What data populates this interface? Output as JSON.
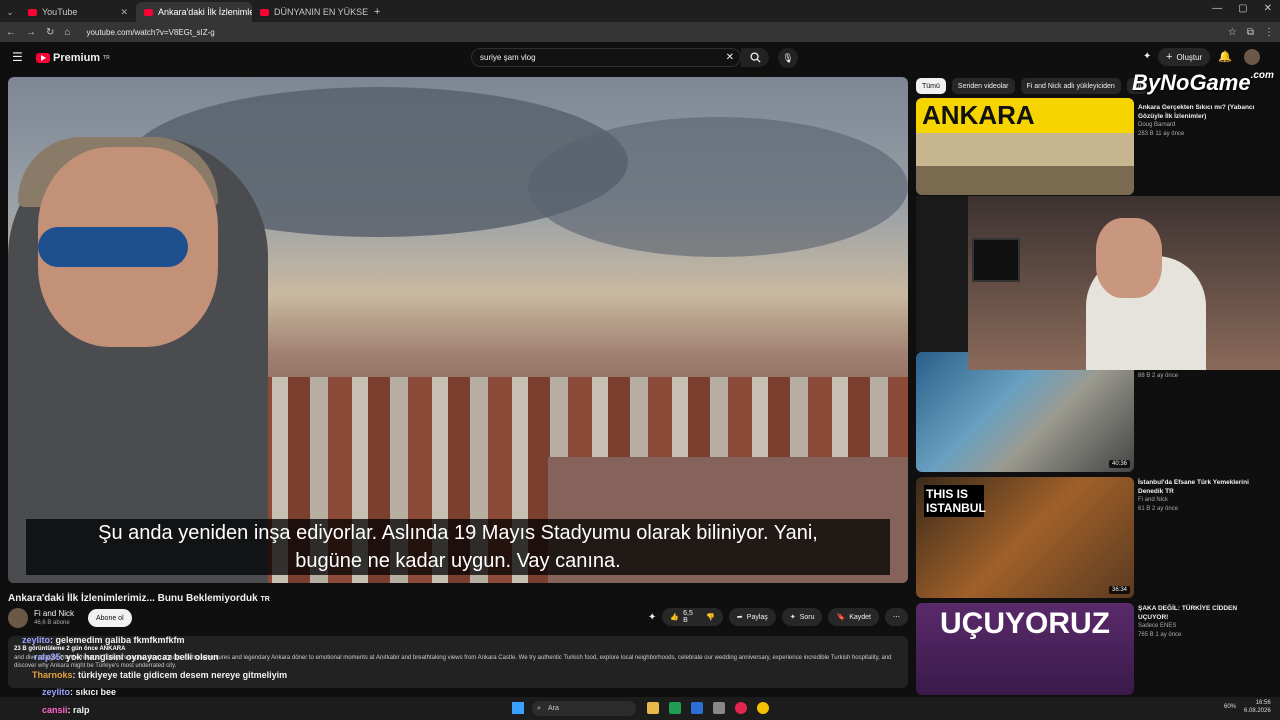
{
  "browser": {
    "tabs": [
      {
        "label": "YouTube",
        "active": false
      },
      {
        "label": "Ankara'daki İlk İzlenimlerimiz...",
        "active": true
      },
      {
        "label": "DÜNYANIN EN YÜKSEK OTELİN...",
        "active": false
      }
    ],
    "url": "youtube.com/watch?v=V8EGt_sIZ-g"
  },
  "youtube": {
    "brand": "Premium",
    "brand_suffix": "TR",
    "search_value": "suriye şam vlog",
    "create_label": "Oluştur"
  },
  "video": {
    "subtitle_line1": "Şu anda yeniden inşa ediyorlar. Aslında 19 Mayıs Stadyumu olarak biliniyor. Yani,",
    "subtitle_line2": "bugüne ne kadar uygun. Vay canına.",
    "title": "Ankara'daki İlk İzlenimlerimiz... Bunu Beklemiyorduk",
    "title_suffix": "TR",
    "channel": "Fi and Nick",
    "subscribers": "46,6 B abone",
    "subscribe_label": "Abone ol",
    "like_count": "6,5 B",
    "share_label": "Paylaş",
    "ask_label": "Soru",
    "save_label": "Kaydet",
    "desc_meta": "23 B görüntüleme  2 gün önce  ANKARA",
    "desc_text": "and dive straight into the heart of Türkiye's capital, from chaotic metro adventures and legendary Ankara döner to emotional moments at Anıtkabir and breathtaking views from Ankara Castle. We try authentic Turkish food, explore local neighborhoods, celebrate our wedding anniversary, experience incredible Turkish hospitality, and discover why Ankara might be Türkiye's most underrated city."
  },
  "chat": [
    {
      "user": "zeylito",
      "msg": ": gelemedim galiba fkmfkmfkfm"
    },
    {
      "user": "ralp35",
      "msg": ": yok hangisini oynayacaz belli olsun"
    },
    {
      "user": "Tharnoks",
      "msg": ": türkiyeye tatile gidicem desem nereye gitmeliyim"
    },
    {
      "user": "zeylito",
      "msg": ": sıkıcı bee"
    },
    {
      "user": "cansii",
      "msg": ": ralp"
    }
  ],
  "chips": [
    "Tümü",
    "Seriden videolar",
    "Fi and Nick adlı yükleyiciden",
    "An"
  ],
  "watermark": "ByNoGame",
  "watermark_suffix": ".com",
  "related": [
    {
      "title": "Ankara Gerçekten Sıkıcı mı? (Yabancı Gözüyle İlk İzlenimler)",
      "channel": "Doug Barnard",
      "meta": "283 B  11 ay önce",
      "duration": "",
      "thumb_text": "ANKARA"
    },
    {
      "title": "",
      "channel": "",
      "meta": "88 B  2 ay önce",
      "duration": "40:36",
      "thumb_text": ""
    },
    {
      "title": "İstanbul'da Efsane Türk Yemeklerini Denedik",
      "title_suffix": "TR",
      "channel": "Fi and Nick",
      "meta": "61 B  2 ay önce",
      "duration": "36:34",
      "thumb_text": "THIS IS ISTANBUL"
    },
    {
      "title": "ŞAKA DEĞİL: TÜRKİYE CİDDEN UÇUYOR!",
      "channel": "Sadece ENES",
      "meta": "765 B  1 ay önce",
      "duration": "",
      "thumb_text": "UÇUYORUZ"
    }
  ],
  "taskbar": {
    "search_placeholder": "Ara",
    "time": "16:56",
    "date": "6.08.2026",
    "battery": "60%"
  },
  "colors": {
    "accent": "#ff0033",
    "bg": "#0f0f0f",
    "pill": "#272727"
  }
}
